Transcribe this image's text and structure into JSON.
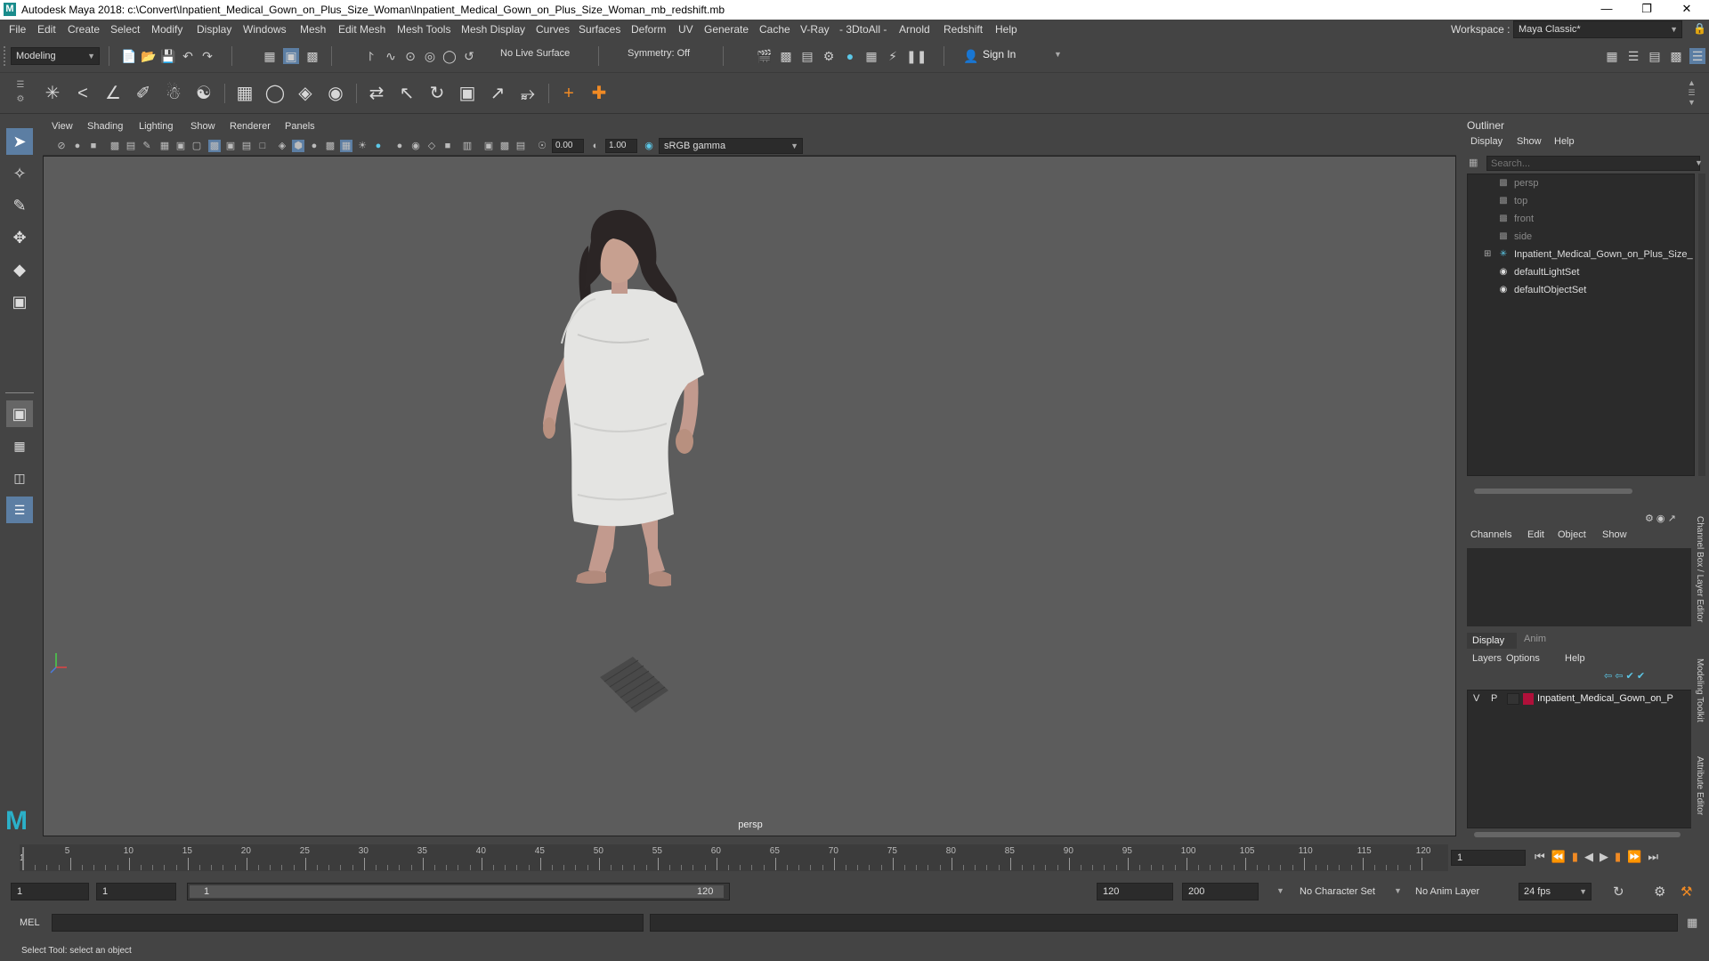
{
  "window": {
    "title": "Autodesk Maya 2018: c:\\Convert\\Inpatient_Medical_Gown_on_Plus_Size_Woman\\Inpatient_Medical_Gown_on_Plus_Size_Woman_mb_redshift.mb",
    "app_icon": "M"
  },
  "menubar": [
    "File",
    "Edit",
    "Create",
    "Select",
    "Modify",
    "Display",
    "Windows",
    "Mesh",
    "Edit Mesh",
    "Mesh Tools",
    "Mesh Display",
    "Curves",
    "Surfaces",
    "Deform",
    "UV",
    "Generate",
    "Cache",
    "V-Ray",
    "- 3DtoAll -",
    "Arnold",
    "Redshift",
    "Help"
  ],
  "workspace": {
    "label": "Workspace :",
    "value": "Maya Classic*"
  },
  "status_line": {
    "mode": "Modeling",
    "live_surface": "No Live Surface",
    "symmetry": "Symmetry: Off",
    "sign_in": "Sign In"
  },
  "viewport": {
    "menus": [
      "View",
      "Shading",
      "Lighting",
      "Show",
      "Renderer",
      "Panels"
    ],
    "exposure": "0.00",
    "gamma": "1.00",
    "color_space": "sRGB gamma",
    "camera_label": "persp",
    "background_color": "#5c5c5c"
  },
  "outliner": {
    "title": "Outliner",
    "menus": [
      "Display",
      "Show",
      "Help"
    ],
    "search_placeholder": "Search...",
    "items": [
      {
        "label": "persp",
        "icon": "camera-icon",
        "dim": true
      },
      {
        "label": "top",
        "icon": "camera-icon",
        "dim": true
      },
      {
        "label": "front",
        "icon": "camera-icon",
        "dim": true
      },
      {
        "label": "side",
        "icon": "camera-icon",
        "dim": true
      },
      {
        "label": "Inpatient_Medical_Gown_on_Plus_Size_",
        "icon": "group-icon",
        "dim": false,
        "expandable": true
      },
      {
        "label": "defaultLightSet",
        "icon": "set-icon",
        "dim": false
      },
      {
        "label": "defaultObjectSet",
        "icon": "set-icon",
        "dim": false
      }
    ]
  },
  "channel_box": {
    "menus": [
      "Channels",
      "Edit",
      "Object",
      "Show"
    ]
  },
  "layer_editor": {
    "tabs": [
      "Display",
      "Anim"
    ],
    "menus": [
      "Layers",
      "Options",
      "Help"
    ],
    "layer": {
      "v": "V",
      "p": "P",
      "name": "Inpatient_Medical_Gown_on_P",
      "color": "#b0103a"
    }
  },
  "side_tabs": [
    "Channel Box / Layer Editor",
    "Modeling Toolkit",
    "Attribute Editor"
  ],
  "timeline": {
    "ticks": [
      "5",
      "10",
      "15",
      "20",
      "25",
      "30",
      "35",
      "40",
      "45",
      "50",
      "55",
      "60",
      "65",
      "70",
      "75",
      "80",
      "85",
      "90",
      "95",
      "100",
      "105",
      "110",
      "115",
      "120"
    ],
    "start_marker": "1",
    "current_frame": "1"
  },
  "range": {
    "start": "1",
    "playback_start": "1",
    "slider_start": "1",
    "slider_end": "120",
    "playback_end": "120",
    "end": "200",
    "character_set": "No Character Set",
    "anim_layer": "No Anim Layer",
    "fps": "24 fps"
  },
  "command_line": {
    "label": "MEL"
  },
  "status": {
    "help_line": "Select Tool: select an object"
  }
}
